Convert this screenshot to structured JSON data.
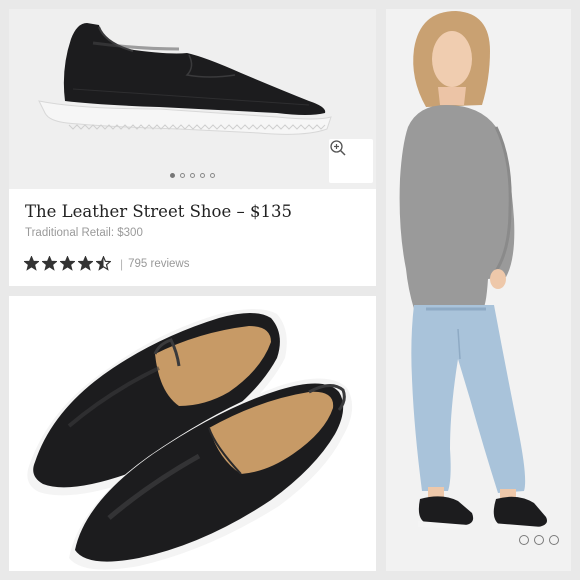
{
  "product": {
    "title": "The Leather Street Shoe – $135",
    "retail": "Traditional Retail: $300",
    "rating_out_of_5": 4.5,
    "rating_separator": "|",
    "reviews": "795 reviews"
  },
  "hero_carousel": {
    "count": 5,
    "active_index": 0
  },
  "model_carousel": {
    "count": 3,
    "active_index": -1
  },
  "colors": {
    "shoe_leather": "#1c1c1e",
    "sole": "#f4f4f4",
    "lining": "#c79a66",
    "sweater": "#9a9a9a",
    "jeans": "#a9c3da",
    "star": "#333333",
    "background": "#e9e9e9"
  },
  "icons": {
    "zoom": "zoom-in-icon",
    "star": "star-icon"
  }
}
